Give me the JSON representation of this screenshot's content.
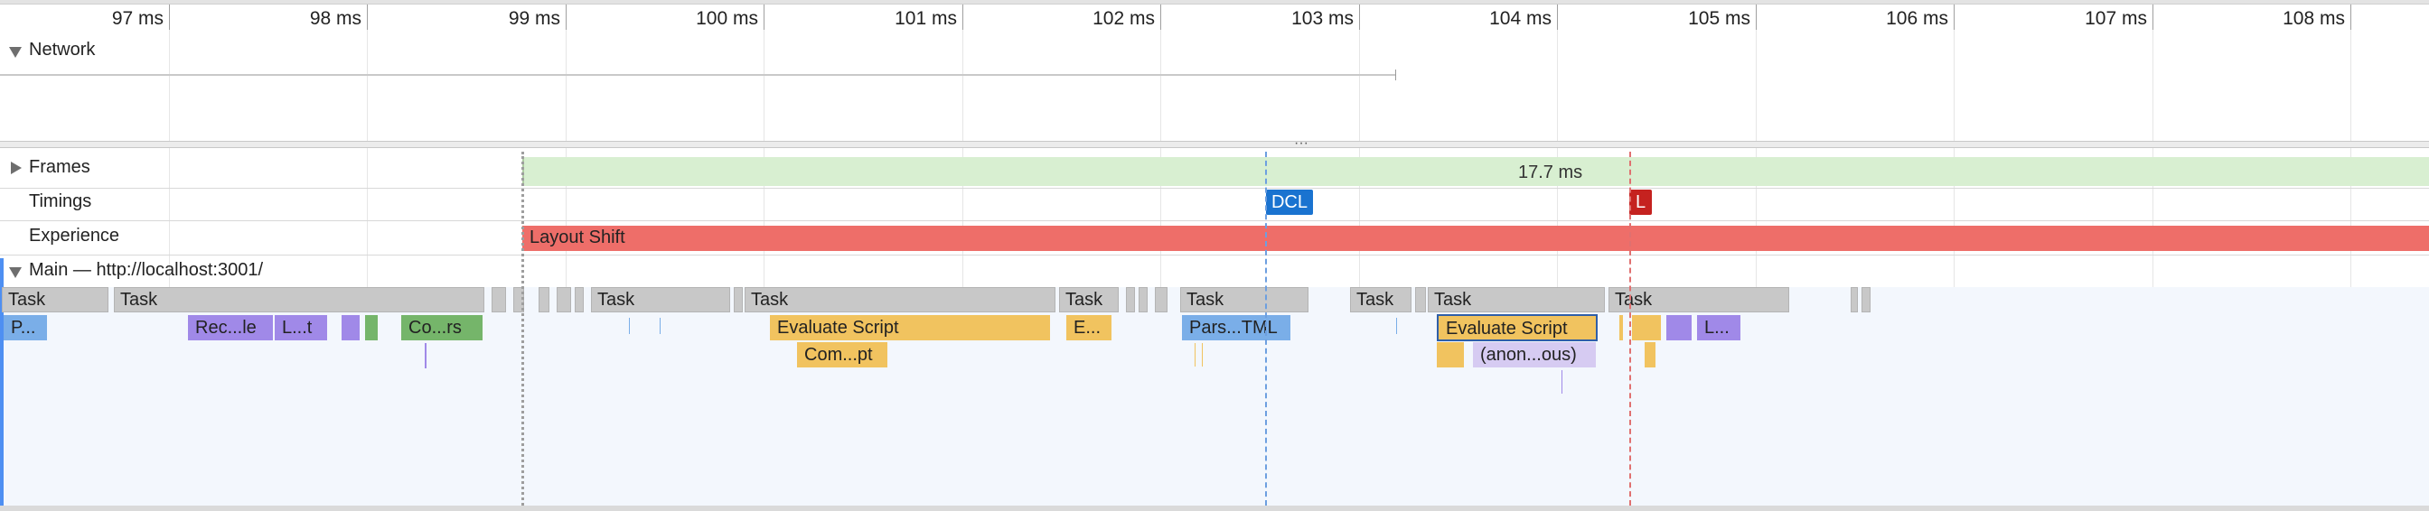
{
  "ruler": {
    "ticks": [
      "97 ms",
      "98 ms",
      "99 ms",
      "100 ms",
      "101 ms",
      "102 ms",
      "103 ms",
      "104 ms",
      "105 ms",
      "106 ms",
      "107 ms",
      "108 ms"
    ]
  },
  "tracks": {
    "network": "Network",
    "frames": "Frames",
    "timings": "Timings",
    "experience": "Experience",
    "main": "Main — http://localhost:3001/"
  },
  "frames": {
    "duration": "17.7 ms"
  },
  "timings": {
    "dcl": "DCL",
    "load": "L"
  },
  "experience": {
    "layout_shift": "Layout Shift"
  },
  "tasks": [
    "Task",
    "Task",
    "Task",
    "Task",
    "Task",
    "Task",
    "Task",
    "Task",
    "Task"
  ],
  "events": {
    "p": "P...",
    "recalc": "Rec...le",
    "layout": "L...t",
    "composite": "Co...rs",
    "evaluate1": "Evaluate Script",
    "compile": "Com...pt",
    "e_short": "E...",
    "parse": "Pars...TML",
    "evaluate2": "Evaluate Script",
    "anon": "(anon...ous)",
    "l_short": "L..."
  },
  "colors": {
    "frames": "#d8efd1",
    "dcl": "#1a73d0",
    "load": "#c5221f",
    "layout_shift": "#ee6e69",
    "task": "#c8c8c8",
    "script": "#f1c35f",
    "rendering": "#a089e8",
    "painting": "#75b56a",
    "loading": "#7aaee8"
  }
}
